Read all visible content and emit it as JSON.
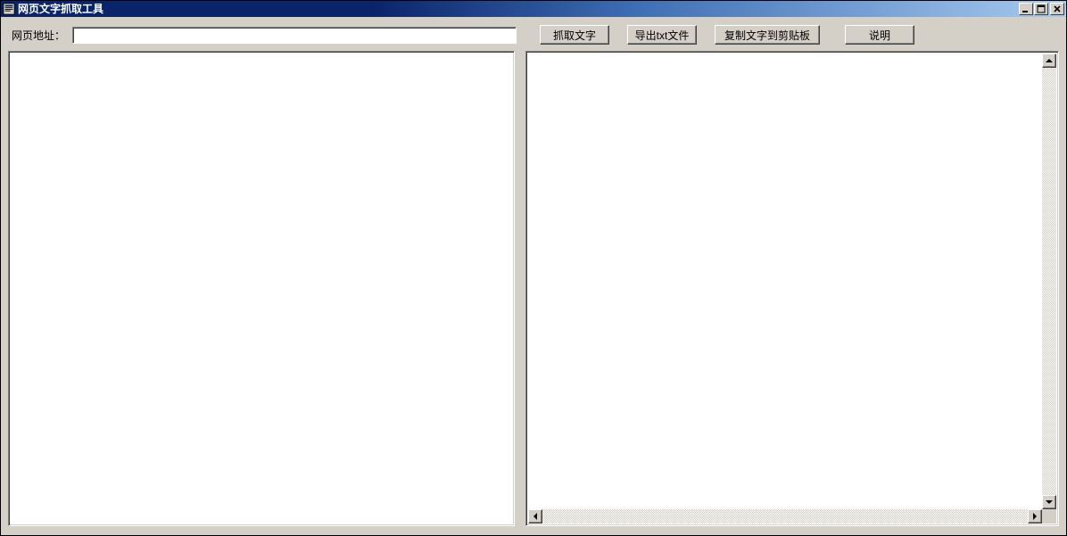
{
  "window": {
    "title": "网页文字抓取工具"
  },
  "toolbar": {
    "url_label": "网页地址：",
    "url_value": "",
    "grab_label": "抓取文字",
    "export_label": "导出txt文件",
    "copy_label": "复制文字到剪贴板",
    "help_label": "说明"
  },
  "panes": {
    "left_content": "",
    "right_content": ""
  }
}
